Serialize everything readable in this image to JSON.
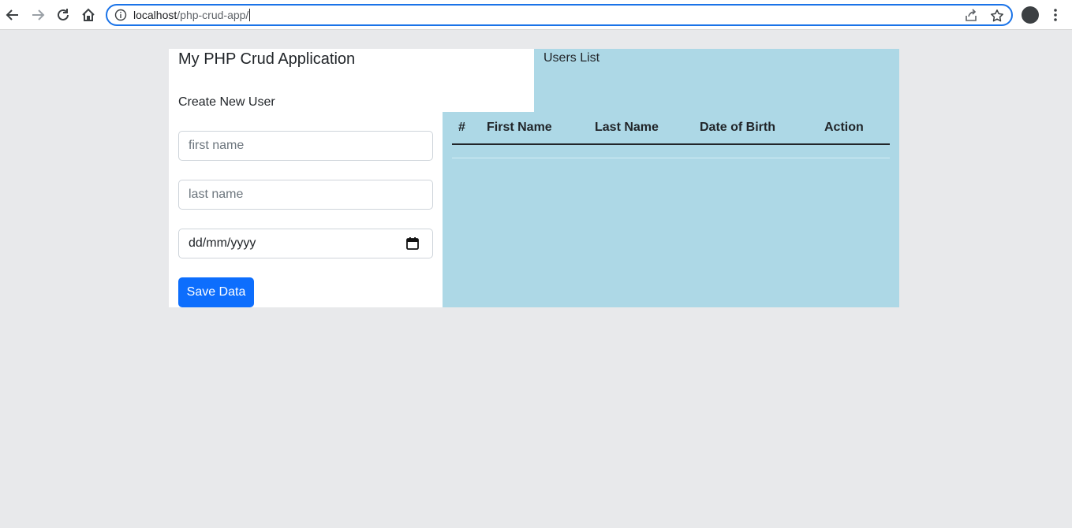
{
  "browser": {
    "url_host": "localhost",
    "url_path": "/php-crud-app/"
  },
  "app": {
    "title": "My PHP Crud Application",
    "list_title": "Users List",
    "form_title": "Create New User"
  },
  "form": {
    "first_name_placeholder": "first name",
    "last_name_placeholder": "last name",
    "date_placeholder": "dd/mm/yyyy",
    "save_label": "Save Data"
  },
  "table": {
    "headers": [
      "#",
      "First Name",
      "Last Name",
      "Date of Birth",
      "Action"
    ],
    "rows": []
  },
  "colors": {
    "accent": "#0d6efd",
    "list_background": "#add8e6",
    "page_background": "#e8e9eb"
  }
}
